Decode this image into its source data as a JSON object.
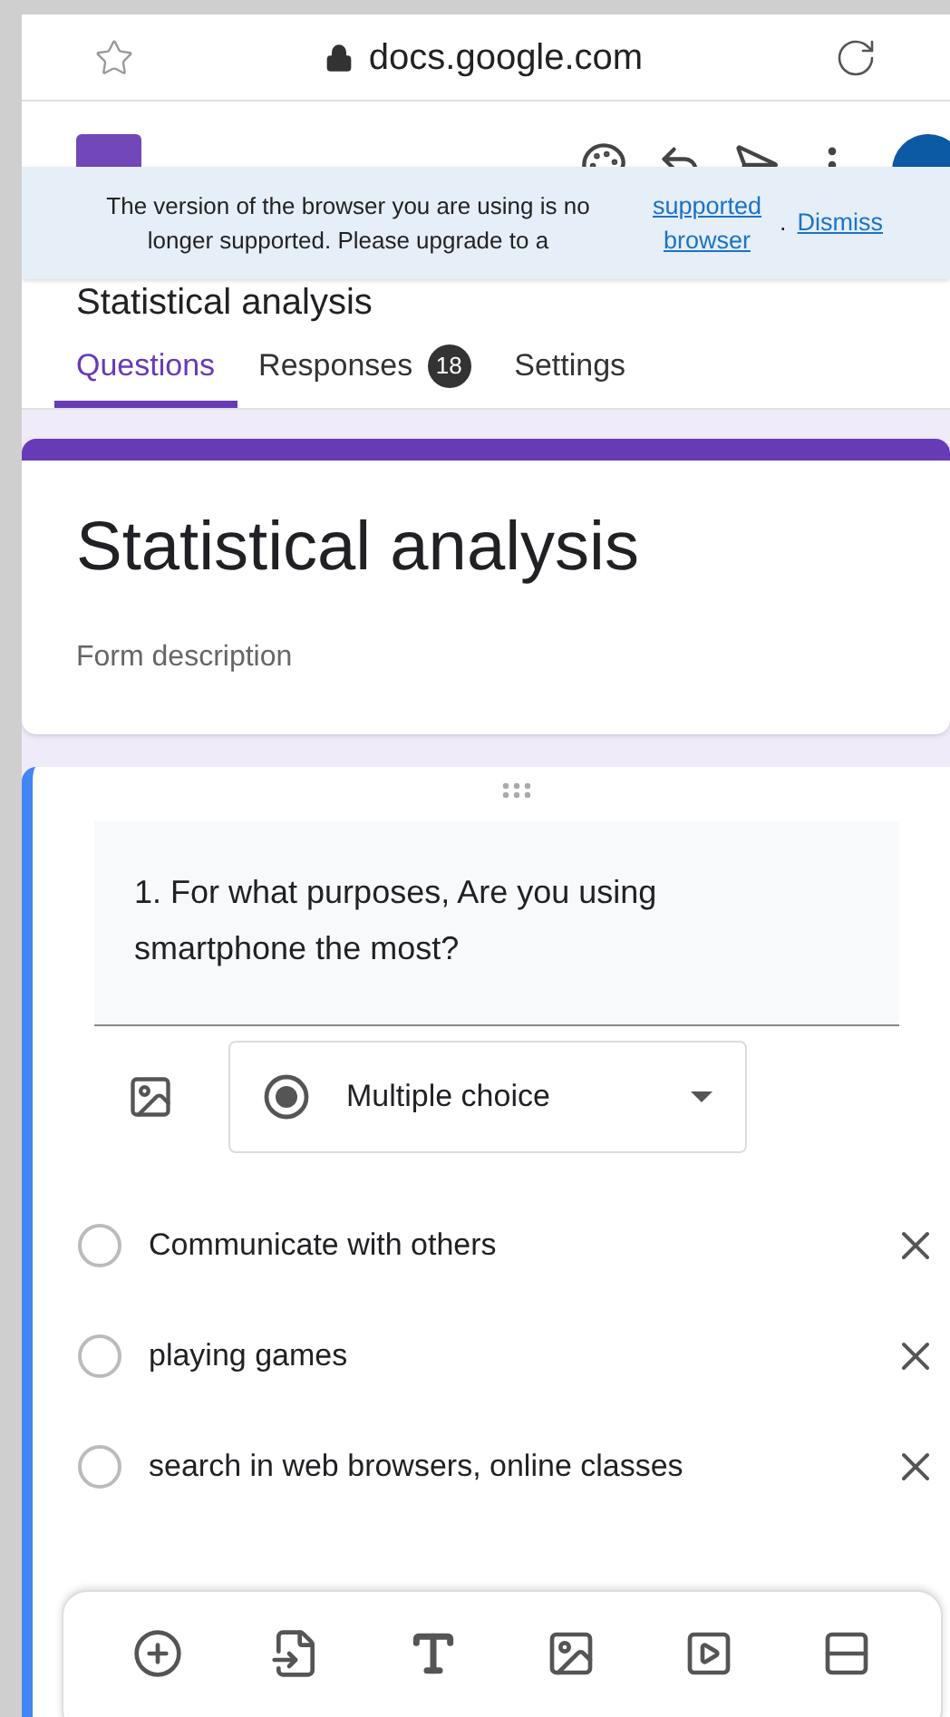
{
  "browser": {
    "url": "docs.google.com"
  },
  "banner": {
    "message": "The version of the browser you are using is no longer supported. Please upgrade to a",
    "link": "supported browser",
    "separator": ".",
    "dismiss": "Dismiss"
  },
  "header": {
    "title": "Statistical analysis"
  },
  "tabs": [
    {
      "label": "Questions",
      "selected": true
    },
    {
      "label": "Responses",
      "selected": false,
      "badge": "18"
    },
    {
      "label": "Settings",
      "selected": false
    }
  ],
  "form": {
    "title": "Statistical analysis",
    "description_placeholder": "Form description"
  },
  "question": {
    "text": "1. For what purposes, Are you using smartphone the most?",
    "type": "Multiple choice",
    "options": [
      {
        "label": "Communicate with others"
      },
      {
        "label": "playing games"
      },
      {
        "label": "search in web browsers, online classes"
      }
    ]
  }
}
